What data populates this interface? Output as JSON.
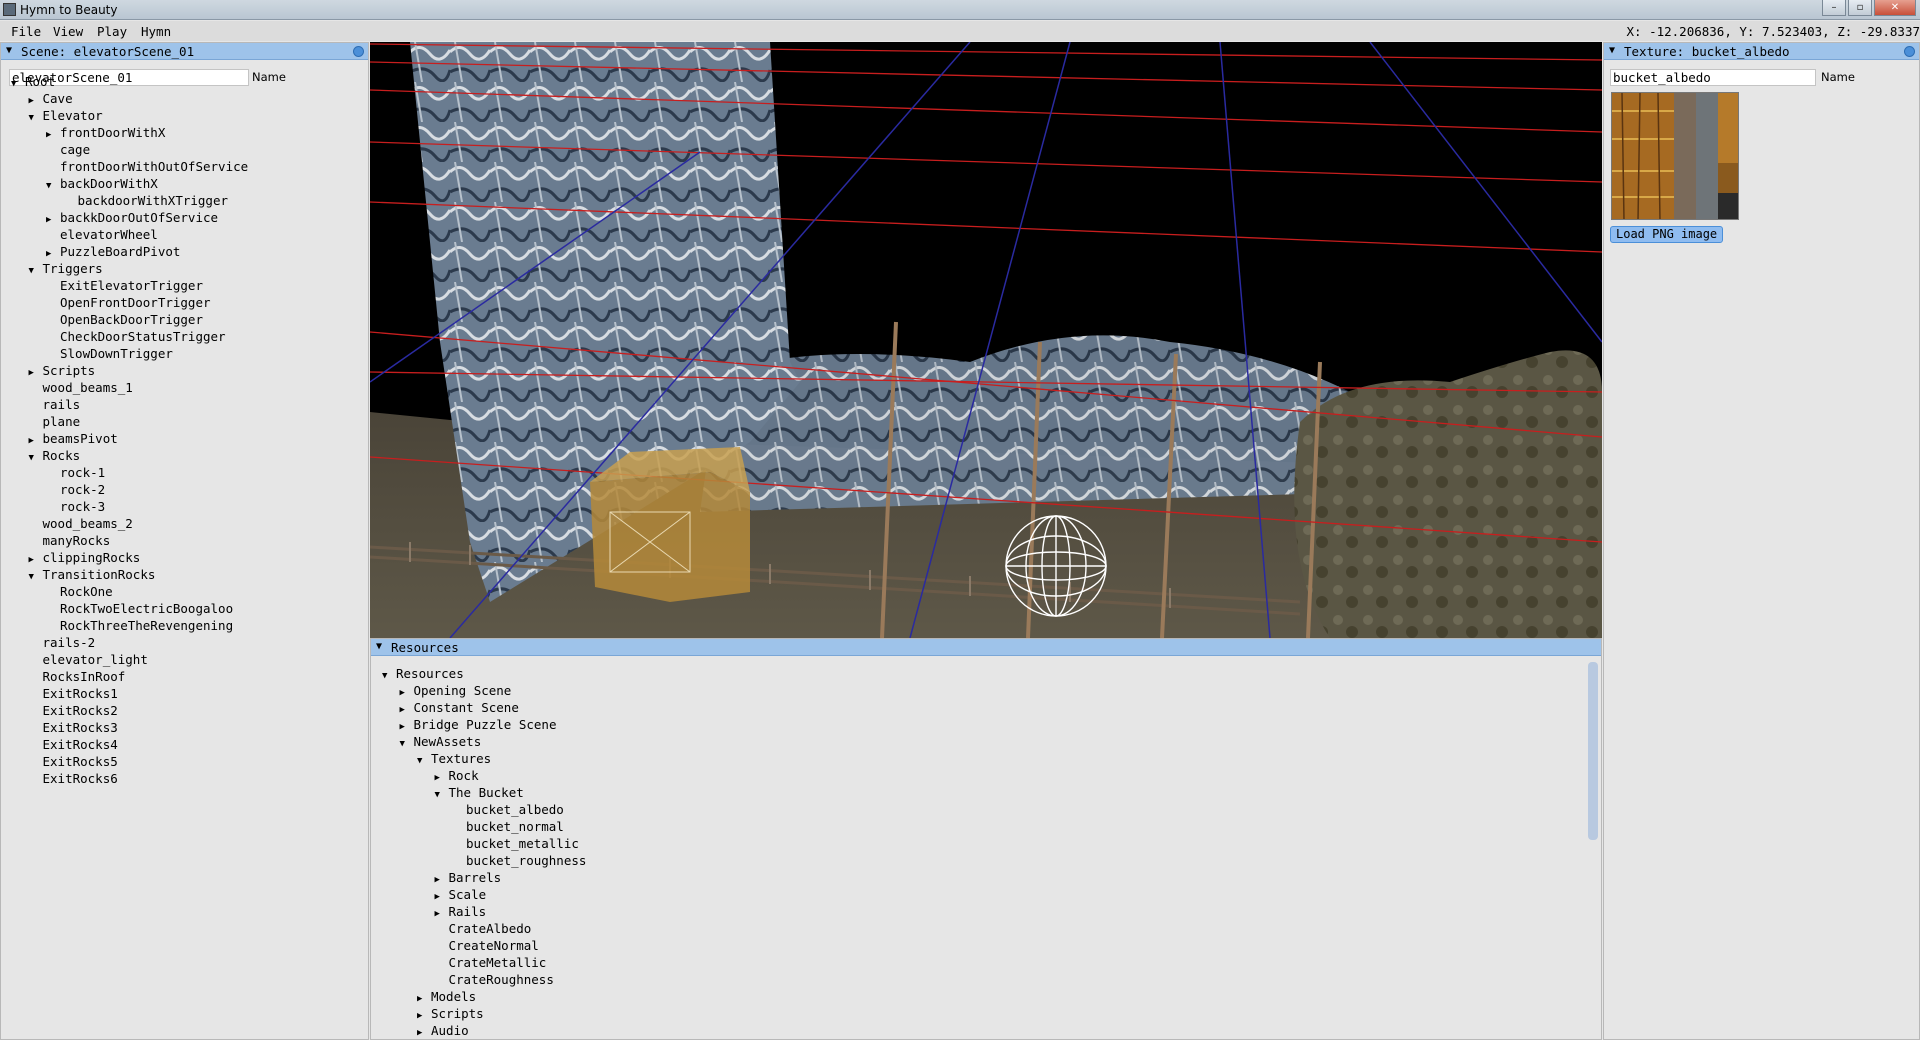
{
  "window": {
    "title": "Hymn to Beauty",
    "buttons": {
      "minimize": "–",
      "maximize": "▫",
      "close": "✕"
    }
  },
  "menubar": {
    "items": [
      "File",
      "View",
      "Play",
      "Hymn"
    ],
    "coords": "X: -12.206836, Y: 7.523403, Z: -29.8337"
  },
  "scene_panel": {
    "header": "Scene: elevatorScene_01",
    "name_value": "elevatorScene_01",
    "name_label": "Name",
    "tree": [
      {
        "label": "Root",
        "depth": 0,
        "state": "open"
      },
      {
        "label": "Cave",
        "depth": 1,
        "state": "closed"
      },
      {
        "label": "Elevator",
        "depth": 1,
        "state": "open"
      },
      {
        "label": "frontDoorWithX",
        "depth": 2,
        "state": "closed"
      },
      {
        "label": "cage",
        "depth": 2,
        "state": "leaf"
      },
      {
        "label": "frontDoorWithOutOfService",
        "depth": 2,
        "state": "leaf"
      },
      {
        "label": "backDoorWithX",
        "depth": 2,
        "state": "open"
      },
      {
        "label": "backdoorWithXTrigger",
        "depth": 3,
        "state": "leaf"
      },
      {
        "label": "backkDoorOutOfService",
        "depth": 2,
        "state": "closed"
      },
      {
        "label": "elevatorWheel",
        "depth": 2,
        "state": "leaf"
      },
      {
        "label": "PuzzleBoardPivot",
        "depth": 2,
        "state": "closed"
      },
      {
        "label": "Triggers",
        "depth": 1,
        "state": "open"
      },
      {
        "label": "ExitElevatorTrigger",
        "depth": 2,
        "state": "leaf"
      },
      {
        "label": "OpenFrontDoorTrigger",
        "depth": 2,
        "state": "leaf"
      },
      {
        "label": "OpenBackDoorTrigger",
        "depth": 2,
        "state": "leaf"
      },
      {
        "label": "CheckDoorStatusTrigger",
        "depth": 2,
        "state": "leaf"
      },
      {
        "label": "SlowDownTrigger",
        "depth": 2,
        "state": "leaf"
      },
      {
        "label": "Scripts",
        "depth": 1,
        "state": "closed"
      },
      {
        "label": "wood_beams_1",
        "depth": 1,
        "state": "leaf"
      },
      {
        "label": "rails",
        "depth": 1,
        "state": "leaf"
      },
      {
        "label": "plane",
        "depth": 1,
        "state": "leaf"
      },
      {
        "label": "beamsPivot",
        "depth": 1,
        "state": "closed"
      },
      {
        "label": "Rocks",
        "depth": 1,
        "state": "open"
      },
      {
        "label": "rock-1",
        "depth": 2,
        "state": "leaf"
      },
      {
        "label": "rock-2",
        "depth": 2,
        "state": "leaf"
      },
      {
        "label": "rock-3",
        "depth": 2,
        "state": "leaf"
      },
      {
        "label": "wood_beams_2",
        "depth": 1,
        "state": "leaf"
      },
      {
        "label": "manyRocks",
        "depth": 1,
        "state": "leaf"
      },
      {
        "label": "clippingRocks",
        "depth": 1,
        "state": "closed"
      },
      {
        "label": "TransitionRocks",
        "depth": 1,
        "state": "open"
      },
      {
        "label": "RockOne",
        "depth": 2,
        "state": "leaf"
      },
      {
        "label": "RockTwoElectricBoogaloo",
        "depth": 2,
        "state": "leaf"
      },
      {
        "label": "RockThreeTheRevengening",
        "depth": 2,
        "state": "leaf"
      },
      {
        "label": "rails-2",
        "depth": 1,
        "state": "leaf"
      },
      {
        "label": "elevator_light",
        "depth": 1,
        "state": "leaf"
      },
      {
        "label": "RocksInRoof",
        "depth": 1,
        "state": "leaf"
      },
      {
        "label": "ExitRocks1",
        "depth": 1,
        "state": "leaf"
      },
      {
        "label": "ExitRocks2",
        "depth": 1,
        "state": "leaf"
      },
      {
        "label": "ExitRocks3",
        "depth": 1,
        "state": "leaf"
      },
      {
        "label": "ExitRocks4",
        "depth": 1,
        "state": "leaf"
      },
      {
        "label": "ExitRocks5",
        "depth": 1,
        "state": "leaf"
      },
      {
        "label": "ExitRocks6",
        "depth": 1,
        "state": "leaf"
      }
    ]
  },
  "texture_panel": {
    "header": "Texture: bucket_albedo",
    "name_value": "bucket_albedo",
    "name_label": "Name",
    "load_button": "Load PNG image"
  },
  "resources_panel": {
    "header": "Resources",
    "tree": [
      {
        "label": "Resources",
        "depth": 0,
        "state": "open"
      },
      {
        "label": "Opening Scene",
        "depth": 1,
        "state": "closed"
      },
      {
        "label": "Constant Scene",
        "depth": 1,
        "state": "closed"
      },
      {
        "label": "Bridge Puzzle Scene",
        "depth": 1,
        "state": "closed"
      },
      {
        "label": "NewAssets",
        "depth": 1,
        "state": "open"
      },
      {
        "label": "Textures",
        "depth": 2,
        "state": "open"
      },
      {
        "label": "Rock",
        "depth": 3,
        "state": "closed"
      },
      {
        "label": "The Bucket",
        "depth": 3,
        "state": "open"
      },
      {
        "label": "bucket_albedo",
        "depth": 4,
        "state": "leaf"
      },
      {
        "label": "bucket_normal",
        "depth": 4,
        "state": "leaf"
      },
      {
        "label": "bucket_metallic",
        "depth": 4,
        "state": "leaf"
      },
      {
        "label": "bucket_roughness",
        "depth": 4,
        "state": "leaf"
      },
      {
        "label": "Barrels",
        "depth": 3,
        "state": "closed"
      },
      {
        "label": "Scale",
        "depth": 3,
        "state": "closed"
      },
      {
        "label": "Rails",
        "depth": 3,
        "state": "closed"
      },
      {
        "label": "CrateAlbedo",
        "depth": 3,
        "state": "leaf"
      },
      {
        "label": "CreateNormal",
        "depth": 3,
        "state": "leaf"
      },
      {
        "label": "CrateMetallic",
        "depth": 3,
        "state": "leaf"
      },
      {
        "label": "CrateRoughness",
        "depth": 3,
        "state": "leaf"
      },
      {
        "label": "Models",
        "depth": 2,
        "state": "closed"
      },
      {
        "label": "Scripts",
        "depth": 2,
        "state": "closed"
      },
      {
        "label": "Audio",
        "depth": 2,
        "state": "closed"
      }
    ]
  },
  "icons": {
    "open": "▼",
    "closed": "▶"
  },
  "colors": {
    "panel_header": "#9ec3ea",
    "grid_red": "#c81e1e",
    "grid_blue": "#2a2aa0"
  }
}
